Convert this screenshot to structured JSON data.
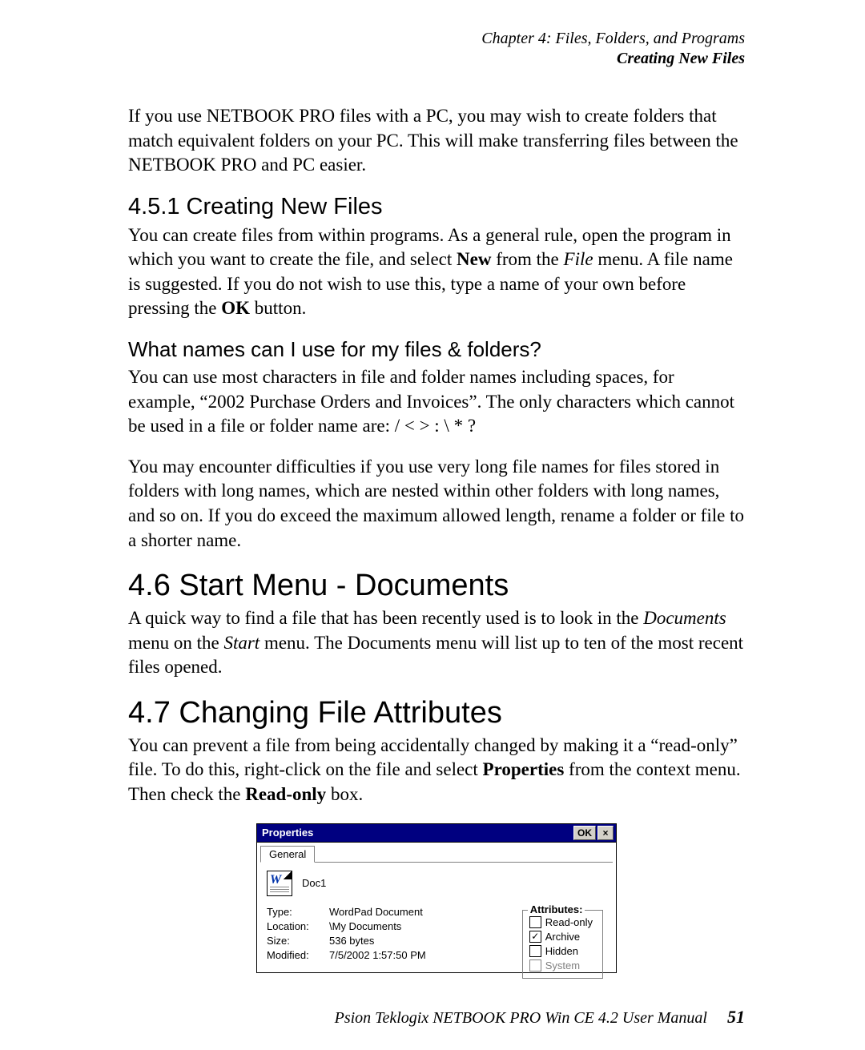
{
  "header": {
    "chapter": "Chapter 4:  Files, Folders, and Programs",
    "section": "Creating New Files"
  },
  "para_intro": "If you use NETBOOK PRO files with a PC, you may wish to create folders that match equivalent folders on your PC. This will make transferring files between the NETBOOK PRO and PC easier.",
  "h_451": "4.5.1  Creating New Files",
  "p_451_pre": "You can create files from within programs. As a general rule, open the program in which you want to create the file, and select ",
  "p_451_new": "New",
  "p_451_mid": " from the ",
  "p_451_file": "File",
  "p_451_mid2": " menu. A file name is suggested. If you do not wish to use this, type a name of your own before pressing the ",
  "p_451_ok": "OK",
  "p_451_end": " button.",
  "h_names": "What names can I use for my files & folders?",
  "p_names1": "You can use most characters in file and folder names including spaces, for example, “2002 Purchase Orders and Invoices”. The only characters which cannot be used in a file or folder name are: / < > : \\ * ?",
  "p_names2": "You may encounter difficulties if you use very long file names for files stored in folders with long names, which are nested within other folders with long names, and so on. If you do exceed the maximum allowed length, rename a folder or file to a shorter name.",
  "h_46": "4.6  Start Menu - Documents",
  "p_46_pre": "A quick way to find a file that has been recently used is to look in the ",
  "p_46_docs": "Documents",
  "p_46_mid": " menu on the ",
  "p_46_start": "Start",
  "p_46_end": " menu. The Documents menu will list up to ten of the most recent files opened.",
  "h_47": "4.7  Changing File Attributes",
  "p_47_pre": "You can prevent a file from being accidentally changed by making it a “read-only” file. To do this, right-click on the file and select ",
  "p_47_props": "Properties",
  "p_47_mid": " from the context menu. Then check the ",
  "p_47_readonly": "Read-only",
  "p_47_end": " box.",
  "dialog": {
    "title": "Properties",
    "ok": "OK",
    "close": "×",
    "tab_general": "General",
    "filename": "Doc1",
    "labels": {
      "type": "Type:",
      "location": "Location:",
      "size": "Size:",
      "modified": "Modified:"
    },
    "values": {
      "type": "WordPad Document",
      "location": "\\My Documents",
      "size": "536 bytes",
      "modified": "7/5/2002 1:57:50 PM"
    },
    "attr_legend": "Attributes:",
    "attrs": {
      "readonly": "Read-only",
      "archive": "Archive",
      "hidden": "Hidden",
      "system": "System"
    }
  },
  "footer": {
    "text": "Psion Teklogix NETBOOK PRO Win CE 4.2 User Manual",
    "page": "51"
  }
}
